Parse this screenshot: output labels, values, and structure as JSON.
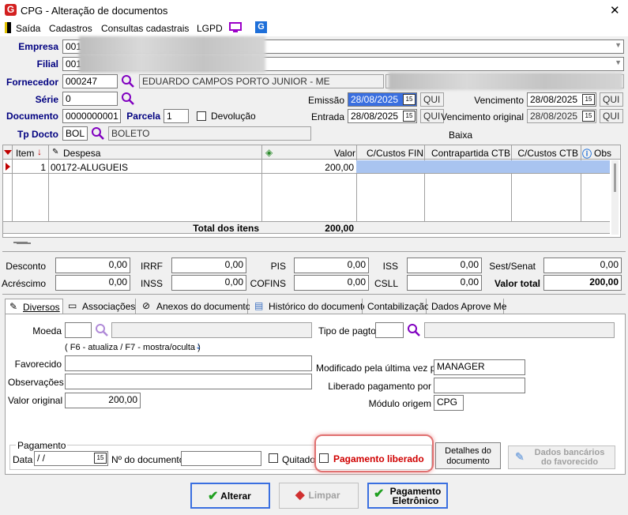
{
  "window": {
    "title": "CPG - Alteração de documentos",
    "close": "✕"
  },
  "menu": {
    "exit": "Saída",
    "cadastros": "Cadastros",
    "consultas": "Consultas cadastrais",
    "lgpd": "LGPD"
  },
  "header": {
    "empresa_label": "Empresa",
    "empresa_value": "001",
    "filial_label": "Filial",
    "filial_value": "001",
    "fornecedor_label": "Fornecedor",
    "fornecedor_code": "000247",
    "fornecedor_name": "EDUARDO CAMPOS PORTO JUNIOR - ME",
    "serie_label": "Série",
    "serie_value": "0",
    "documento_label": "Documento",
    "documento_value": "0000000001",
    "parcela_label": "Parcela",
    "parcela_value": "1",
    "devolucao_label": "Devolução",
    "tpdocto_label": "Tp Docto",
    "tpdocto_code": "BOL",
    "tpdocto_name": "BOLETO",
    "emissao_label": "Emissão",
    "emissao_date": "28/08/2025",
    "emissao_day": "QUI",
    "entrada_label": "Entrada",
    "entrada_date": "28/08/2025",
    "entrada_day": "QUI",
    "vencimento_label": "Vencimento",
    "vencimento_date": "28/08/2025",
    "vencimento_day": "QUI",
    "venc_original_label": "Vencimento original",
    "venc_original_date": "28/08/2025",
    "venc_original_day": "QUI",
    "baixa_label": "Baixa"
  },
  "grid": {
    "columns": {
      "item": "Item",
      "despesa": "Despesa",
      "valor": "Valor",
      "cfin": "C/Custos FIN",
      "contrapartida": "Contrapartida CTB",
      "cctb": "C/Custos CTB",
      "obs": "Obs"
    },
    "rows": [
      {
        "item": "1",
        "despesa": "00172-ALUGUEIS",
        "valor": "200,00"
      }
    ],
    "total_label": "Total dos itens",
    "total_value": "200,00"
  },
  "totals": {
    "desconto_label": "Desconto",
    "desconto": "0,00",
    "acrescimo_label": "Acréscimo",
    "acrescimo": "0,00",
    "irrf_label": "IRRF",
    "irrf": "0,00",
    "inss_label": "INSS",
    "inss": "0,00",
    "pis_label": "PIS",
    "pis": "0,00",
    "cofins_label": "COFINS",
    "cofins": "0,00",
    "iss_label": "ISS",
    "iss": "0,00",
    "csll_label": "CSLL",
    "csll": "0,00",
    "sest_label": "Sest/Senat",
    "sest": "0,00",
    "valor_total_label": "Valor total",
    "valor_total": "200,00"
  },
  "tabs": [
    "Diversos",
    "Associações",
    "Anexos do documento",
    "Histórico do documento",
    "Contabilização",
    "Dados Aprove Me"
  ],
  "diversos": {
    "moeda_label": "Moeda",
    "tipo_pagto_label": "Tipo de pagto",
    "hint": "( F6 - atualiza / F7 - mostra/oculta )",
    "favorecido_label": "Favorecido",
    "observacoes_label": "Observações",
    "valor_original_label": "Valor original",
    "valor_original": "200,00",
    "modificado_label": "Modificado pela última vez por",
    "modificado_value": "MANAGER",
    "liberado_label": "Liberado pagamento por",
    "liberado_value": "",
    "modulo_label": "Módulo origem",
    "modulo_value": "CPG"
  },
  "pagamento": {
    "group_label": "Pagamento",
    "data_label": "Data",
    "data_value": " /  /",
    "ndoc_label": "Nº do documento",
    "ndoc_value": "",
    "quitado_label": "Quitado",
    "liberado_label": "Pagamento liberado",
    "detalhes_label": "Detalhes do documento",
    "dados_bancarios_label": "Dados bancários do favorecido"
  },
  "buttons": {
    "alterar": "Alterar",
    "limpar": "Limpar",
    "pagamento_eletronico": "Pagamento Eletrônico"
  },
  "colors": {
    "label_blue": "#000080",
    "highlight_red": "#e05050",
    "selected_blue": "#3a6fe0"
  }
}
